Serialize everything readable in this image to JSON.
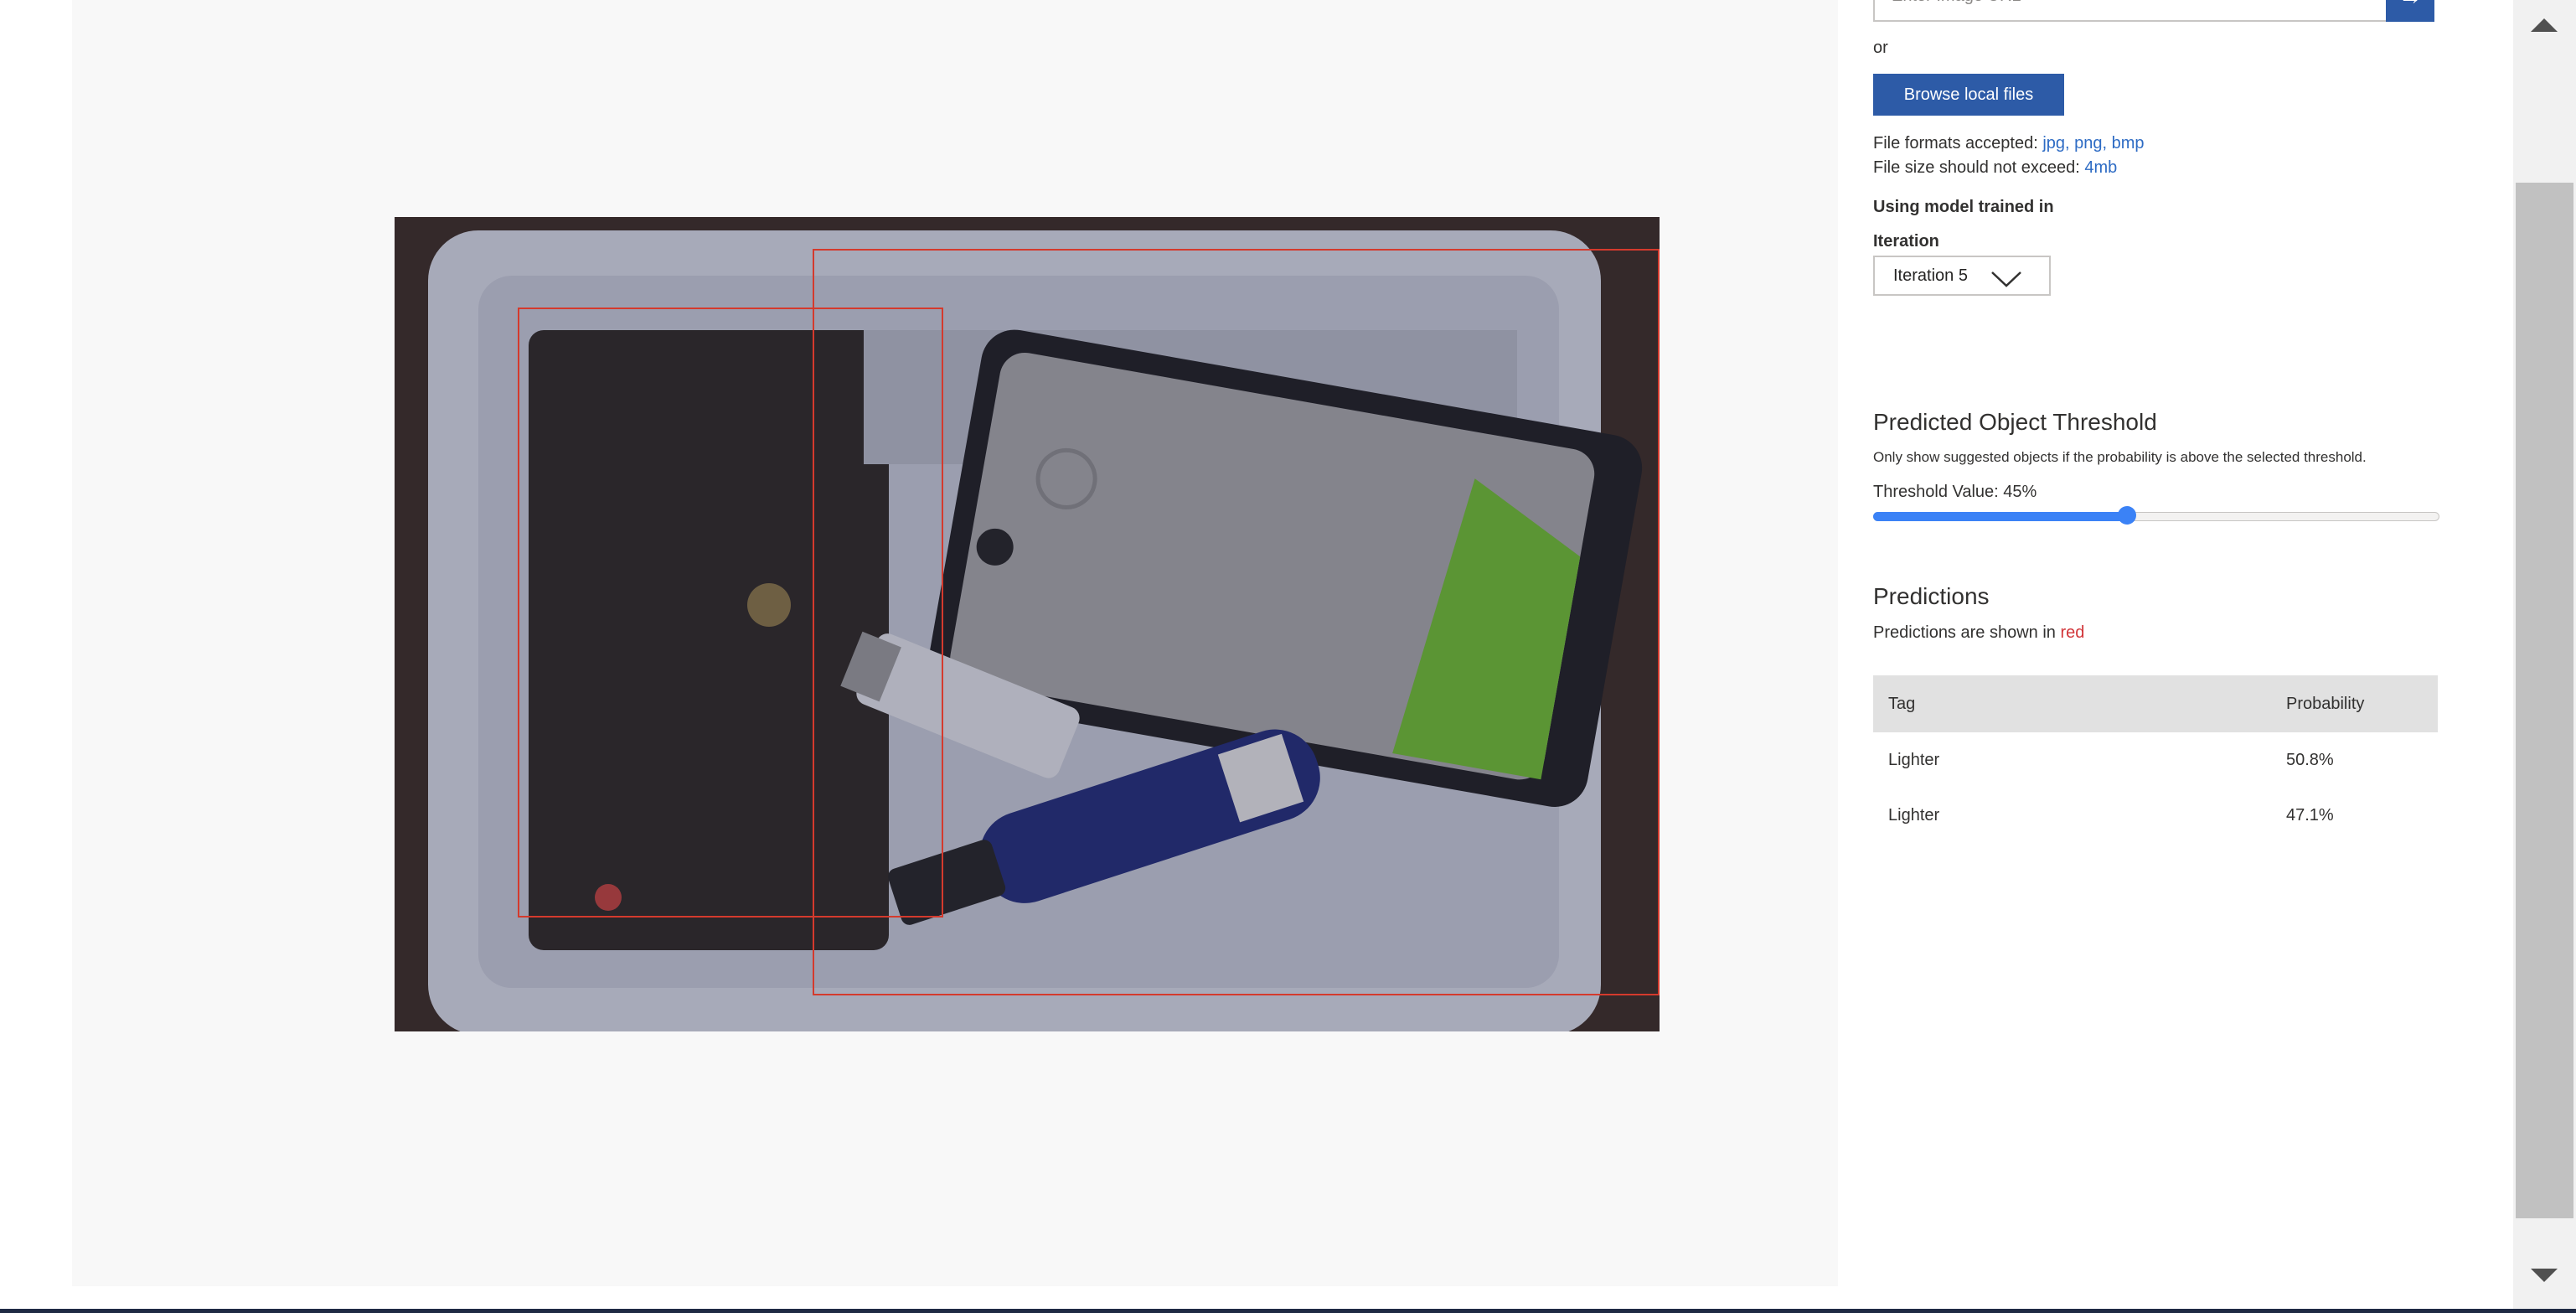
{
  "image_panel": {
    "predictions_overlay_color": "#d43a2d"
  },
  "upload": {
    "url_placeholder": "Enter Image URL",
    "go_icon": "arrow-right-icon",
    "or_text": "or",
    "browse_label": "Browse local files",
    "formats_label": "File formats accepted:",
    "formats_value": "jpg, png, bmp",
    "size_label": "File size should not exceed:",
    "size_value": "4mb"
  },
  "model": {
    "using_model_label": "Using model trained in",
    "iteration_label": "Iteration",
    "iteration_value": "Iteration 5",
    "dropdown_icon": "chevron-down-icon"
  },
  "threshold": {
    "title": "Predicted Object Threshold",
    "description": "Only show suggested objects if the probability is above the selected threshold.",
    "value_label": "Threshold Value: 45%",
    "value_fraction": 0.45
  },
  "predictions": {
    "title": "Predictions",
    "shown_in_prefix": "Predictions are shown in",
    "shown_in_color": "red",
    "columns": {
      "tag": "Tag",
      "probability": "Probability"
    },
    "rows": [
      {
        "tag": "Lighter",
        "probability": "50.8%"
      },
      {
        "tag": "Lighter",
        "probability": "47.1%"
      }
    ]
  },
  "scrollbar": {
    "up_icon": "triangle-up-icon",
    "down_icon": "triangle-down-icon"
  }
}
